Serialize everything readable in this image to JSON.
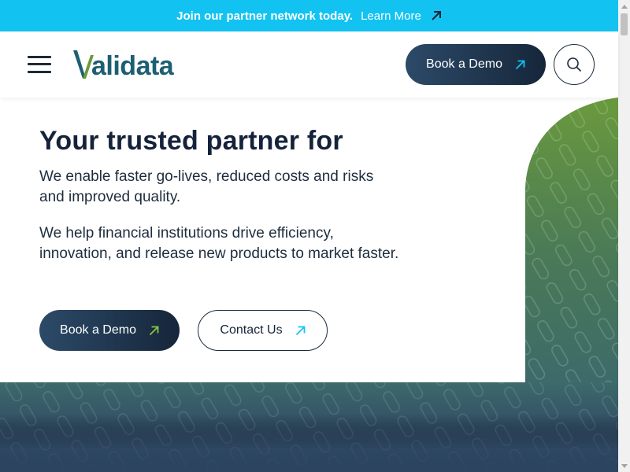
{
  "announcement": {
    "text": "Join our partner network today.",
    "link": "Learn More"
  },
  "header": {
    "logo_text": "alidata",
    "logo_initial": "V",
    "book_demo": "Book a Demo"
  },
  "hero": {
    "title": "Your trusted partner for",
    "paragraph1": "We enable faster go-lives, reduced costs and risks and improved quality.",
    "paragraph2": "We help financial institutions drive efficiency, innovation, and release new products to market faster.",
    "book_demo": "Book a Demo",
    "contact": "Contact Us"
  },
  "icons": {
    "menu": "hamburger-menu-icon",
    "search": "search-icon",
    "arrow": "arrow-up-right-icon"
  },
  "colors": {
    "announce_bg": "#12c3f2",
    "brand_teal": "#1d5f72",
    "brand_green": "#6a9a3c",
    "navy": "#1b2a3a",
    "arrow_cyan": "#12c3f2",
    "arrow_green": "#8cc63f"
  }
}
